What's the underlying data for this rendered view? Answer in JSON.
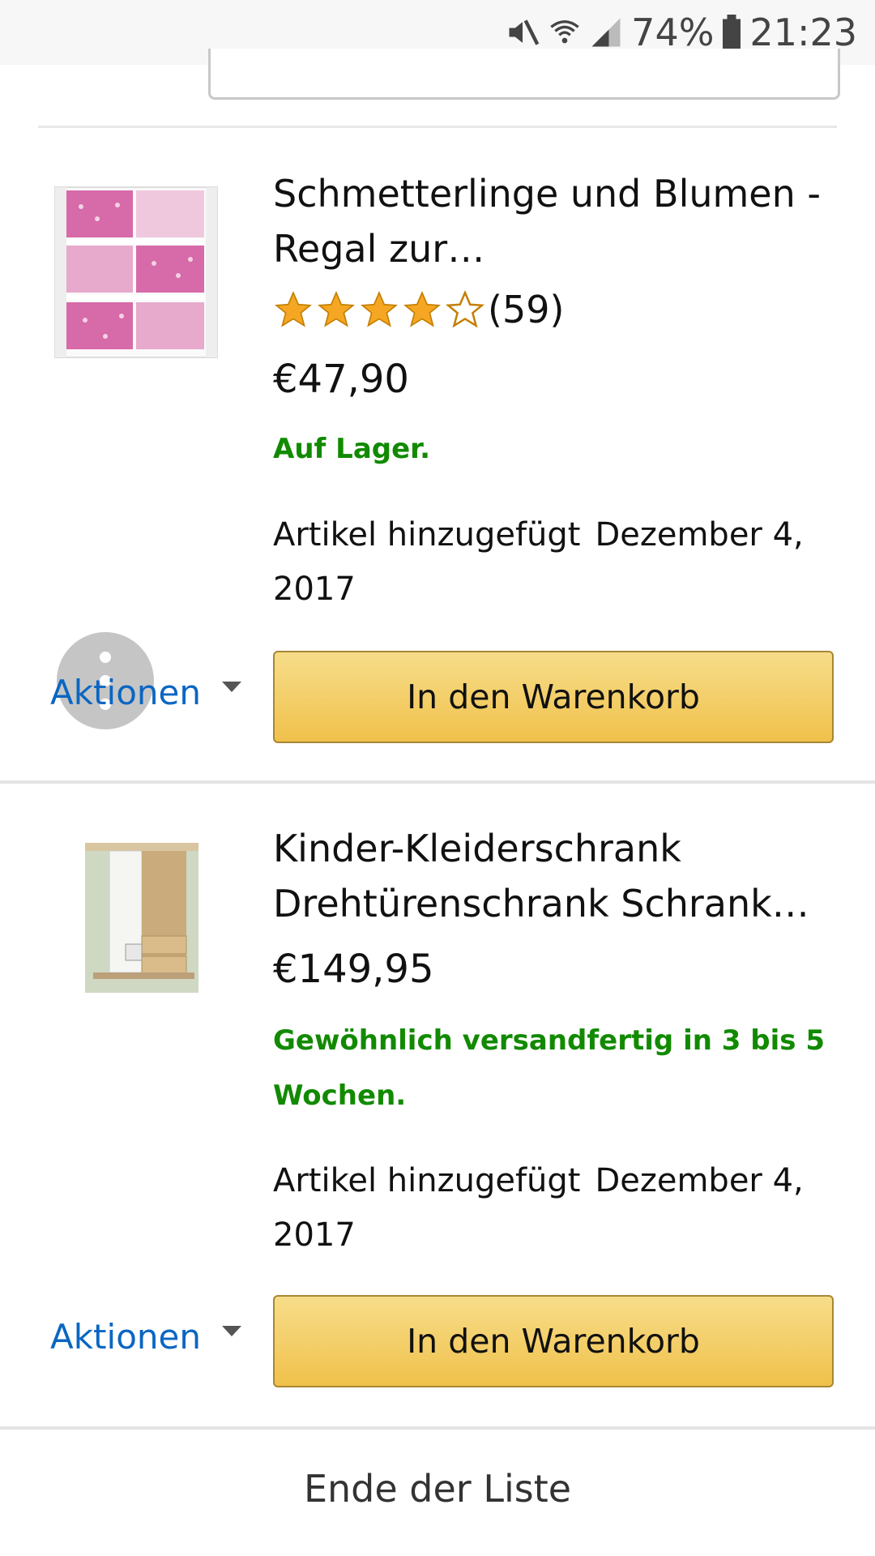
{
  "status_bar": {
    "battery": "74%",
    "time": "21:23"
  },
  "items": [
    {
      "title_line1": "Schmetterlinge und Blumen -",
      "title_line2": "Regal zur…",
      "rating_count": "(59)",
      "rating_stars": 4,
      "price": "€47,90",
      "availability": "Auf Lager.",
      "added_label": "Artikel hinzugefügt",
      "added_date_part1": "Dezember 4,",
      "added_date_part2": "2017",
      "actions_label": "Aktionen",
      "cart_button": "In den Warenkorb"
    },
    {
      "title_line1": "Kinder-Kleiderschrank",
      "title_line2": "Drehtürenschrank Schrank…",
      "price": "€149,95",
      "availability": "Gewöhnlich versandfertig in 3 bis 5 Wochen.",
      "added_label": "Artikel hinzugefügt",
      "added_date_part1": "Dezember 4,",
      "added_date_part2": "2017",
      "actions_label": "Aktionen",
      "cart_button": "In den Warenkorb"
    }
  ],
  "footer": {
    "end_of_list": "Ende der Liste"
  },
  "colors": {
    "accent_link": "#0a66c2",
    "in_stock": "#118a00",
    "button": "#f0c14b",
    "star": "#f5a623"
  },
  "icons": [
    "mute-icon",
    "wifi-icon",
    "signal-icon",
    "battery-icon",
    "star-icon",
    "caret-down-icon",
    "more-vert-icon"
  ]
}
